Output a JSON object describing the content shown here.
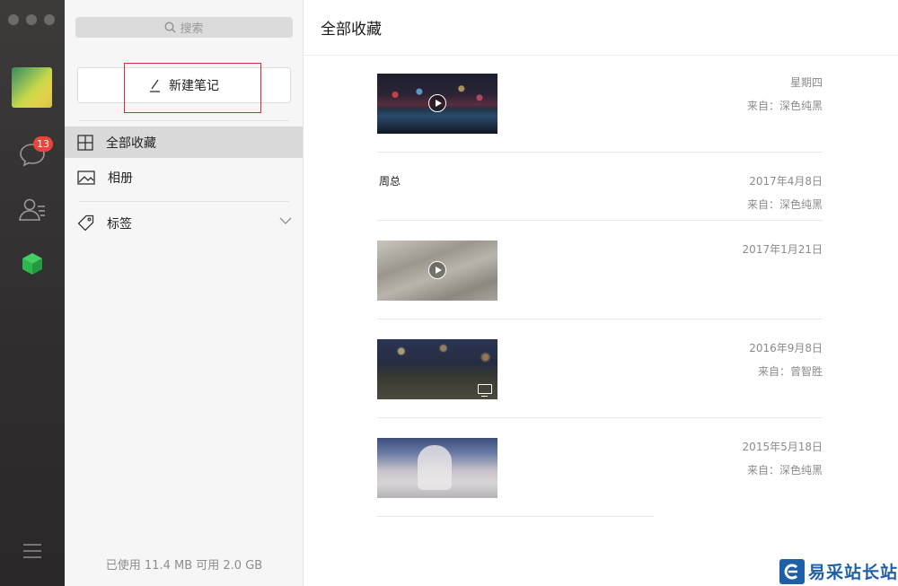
{
  "rail": {
    "chat_badge": "13",
    "icons": [
      "chat-icon",
      "contacts-icon",
      "cube-icon",
      "menu-icon"
    ]
  },
  "sidebar": {
    "search_placeholder": "搜索",
    "new_note_label": "新建笔记",
    "nav": [
      {
        "label": "全部收藏",
        "icon": "grid-icon",
        "active": true
      },
      {
        "label": "相册",
        "icon": "image-icon",
        "active": false
      },
      {
        "label": "标签",
        "icon": "tag-icon",
        "active": false
      }
    ],
    "storage": "已使用 11.4 MB 可用 2.0 GB"
  },
  "main": {
    "title": "全部收藏",
    "entries": [
      {
        "date": "星期四",
        "from": "来自：深色纯黑",
        "title": "",
        "kind": "video"
      },
      {
        "date": "2017年4月8日",
        "from": "来自：深色纯黑",
        "title": "周总",
        "kind": "text"
      },
      {
        "date": "2017年1月21日",
        "from": "",
        "title": "",
        "kind": "video"
      },
      {
        "date": "2016年9月8日",
        "from": "来自：曾智胜",
        "title": "",
        "kind": "video-tv"
      },
      {
        "date": "2015年5月18日",
        "from": "来自：深色纯黑",
        "title": "",
        "kind": "image"
      }
    ]
  },
  "watermark": {
    "text": "易采站长站"
  },
  "colors": {
    "rail_bg": "#2f2d2e",
    "badge": "#e8453c",
    "cube_green": "#2db84d",
    "highlight_box": "#c9303a"
  }
}
